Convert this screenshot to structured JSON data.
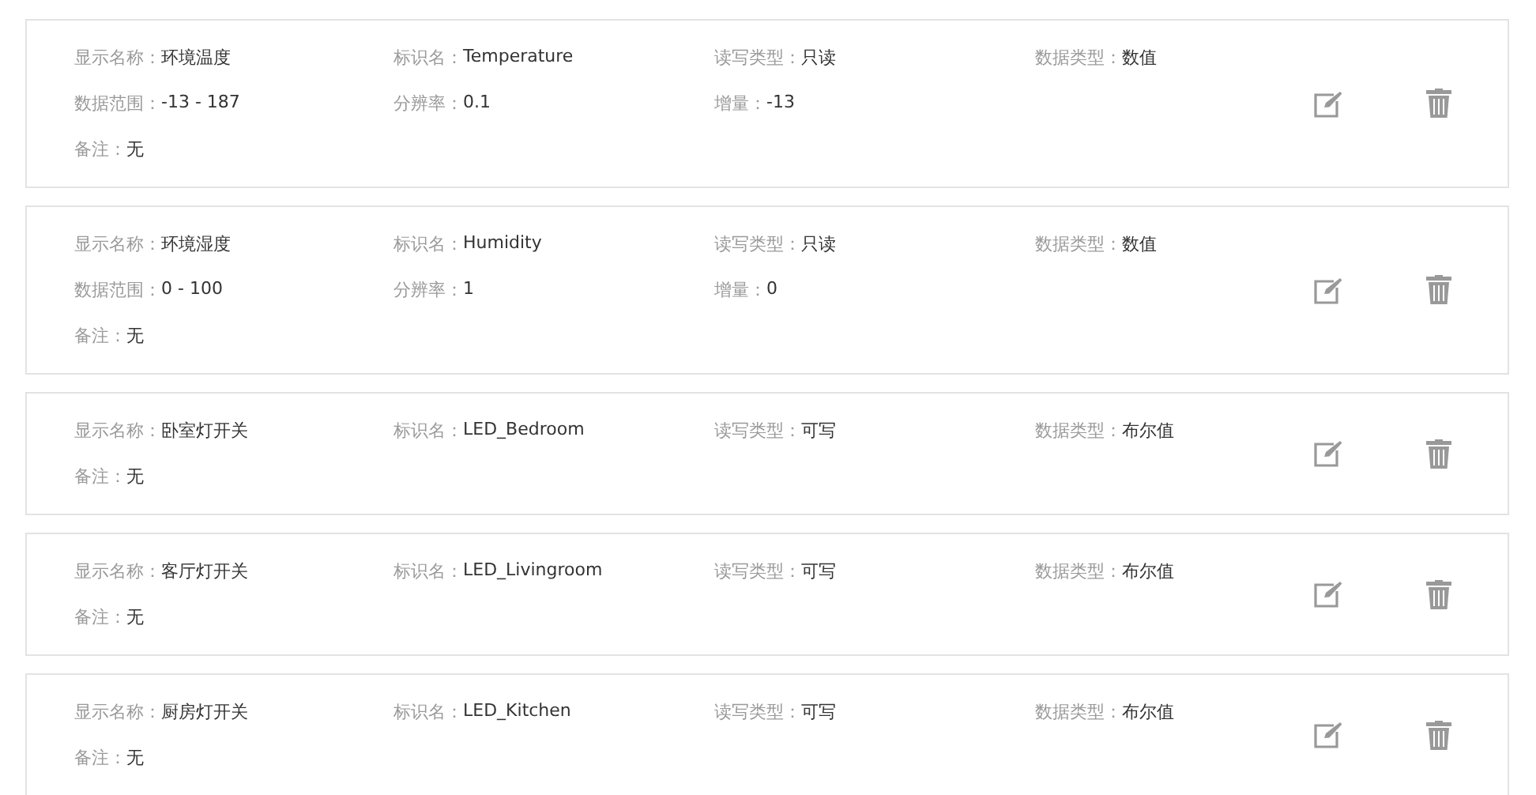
{
  "devices": [
    {
      "rows": [
        [
          {
            "label": "显示名称：",
            "value": "环境温度"
          },
          {
            "label": "标识名：",
            "value": "Temperature"
          },
          {
            "label": "读写类型：",
            "value": "只读"
          },
          {
            "label": "数据类型：",
            "value": "数值"
          }
        ],
        [
          {
            "label": "数据范围：",
            "value": "-13 - 187"
          },
          {
            "label": "分辨率：",
            "value": "0.1"
          },
          {
            "label": "增量：",
            "value": "-13"
          }
        ],
        [
          {
            "label": "备注：",
            "value": "无"
          }
        ]
      ]
    },
    {
      "rows": [
        [
          {
            "label": "显示名称：",
            "value": "环境湿度"
          },
          {
            "label": "标识名：",
            "value": "Humidity"
          },
          {
            "label": "读写类型：",
            "value": "只读"
          },
          {
            "label": "数据类型：",
            "value": "数值"
          }
        ],
        [
          {
            "label": "数据范围：",
            "value": "0 - 100"
          },
          {
            "label": "分辨率：",
            "value": "1"
          },
          {
            "label": "增量：",
            "value": "0"
          }
        ],
        [
          {
            "label": "备注：",
            "value": "无"
          }
        ]
      ]
    },
    {
      "rows": [
        [
          {
            "label": "显示名称：",
            "value": "卧室灯开关"
          },
          {
            "label": "标识名：",
            "value": "LED_Bedroom"
          },
          {
            "label": "读写类型：",
            "value": "可写"
          },
          {
            "label": "数据类型：",
            "value": "布尔值"
          }
        ],
        [
          {
            "label": "备注：",
            "value": "无"
          }
        ]
      ]
    },
    {
      "rows": [
        [
          {
            "label": "显示名称：",
            "value": "客厅灯开关"
          },
          {
            "label": "标识名：",
            "value": "LED_Livingroom"
          },
          {
            "label": "读写类型：",
            "value": "可写"
          },
          {
            "label": "数据类型：",
            "value": "布尔值"
          }
        ],
        [
          {
            "label": "备注：",
            "value": "无"
          }
        ]
      ]
    },
    {
      "rows": [
        [
          {
            "label": "显示名称：",
            "value": "厨房灯开关"
          },
          {
            "label": "标识名：",
            "value": "LED_Kitchen"
          },
          {
            "label": "读写类型：",
            "value": "可写"
          },
          {
            "label": "数据类型：",
            "value": "布尔值"
          }
        ],
        [
          {
            "label": "备注：",
            "value": "无"
          }
        ]
      ]
    }
  ]
}
